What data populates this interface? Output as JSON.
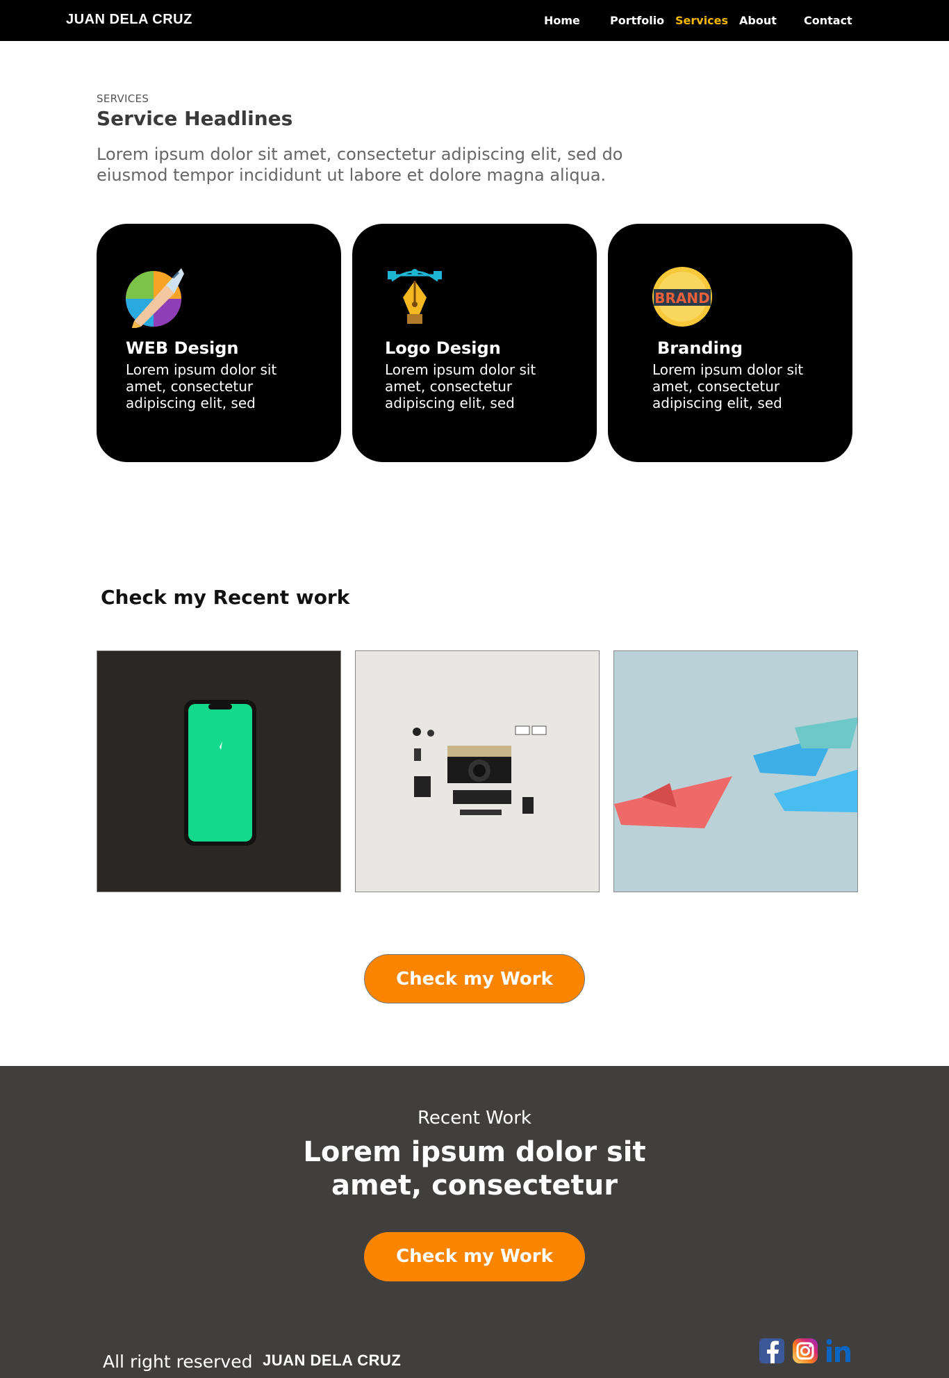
{
  "nav": {
    "brand": "JUAN DELA CRUZ",
    "links": [
      "Home",
      "Portfolio",
      "Services",
      "About",
      "Contact"
    ],
    "active": "Services"
  },
  "services": {
    "eyebrow": "SERVICES",
    "title": "Service Headlines",
    "lead": "Lorem ipsum dolor sit amet, consectetur adipiscing elit, sed do eiusmod tempor incididunt ut labore et dolore magna aliqua.",
    "cards": [
      {
        "icon": "web-design-icon",
        "title": "WEB Design",
        "text": "Lorem ipsum dolor sit amet, consectetur adipiscing elit, sed"
      },
      {
        "icon": "pen-tool-icon",
        "title": "Logo Design",
        "text": "Lorem ipsum dolor sit amet, consectetur adipiscing elit, sed"
      },
      {
        "icon": "brand-badge-icon",
        "title": "Branding",
        "text": "Lorem ipsum dolor sit amet, consectetur adipiscing elit, sed"
      }
    ],
    "brand_badge_text": "BRAND"
  },
  "recent": {
    "title": "Check my Recent work",
    "thumbs": [
      "phone-photo",
      "camera-flatlay-photo",
      "paper-boats-photo"
    ],
    "button": "Check my Work"
  },
  "footer": {
    "eyebrow": "Recent Work",
    "headline": "Lorem ipsum dolor sit amet, consectetur",
    "button": "Check my Work",
    "rights": "All right reserved",
    "brand": "JUAN DELA CRUZ",
    "social": [
      "facebook-icon",
      "instagram-icon",
      "linkedin-icon"
    ]
  },
  "colors": {
    "nav_bg": "#000000",
    "accent_active": "#f5b800",
    "button": "#fb8500",
    "footer_bg": "#403f3e"
  }
}
